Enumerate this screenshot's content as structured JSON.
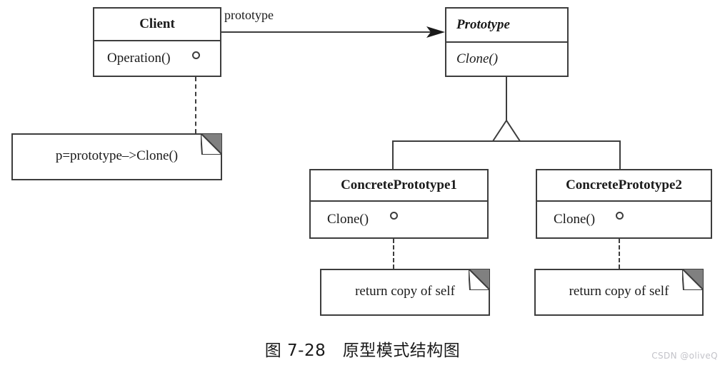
{
  "diagram": {
    "type": "uml-class-diagram",
    "caption": "图 7-28　原型模式结构图",
    "watermark": "CSDN @oliveQ",
    "classes": [
      {
        "id": "client",
        "name": "Client",
        "abstract": false,
        "members": "Operation()"
      },
      {
        "id": "prototype",
        "name": "Prototype",
        "abstract": true,
        "members": "Clone()"
      },
      {
        "id": "concrete1",
        "name": "ConcretePrototype1",
        "abstract": false,
        "members": "Clone()"
      },
      {
        "id": "concrete2",
        "name": "ConcretePrototype2",
        "abstract": false,
        "members": "Clone()"
      }
    ],
    "notes": [
      {
        "id": "note-client",
        "text": "p=prototype–>Clone()"
      },
      {
        "id": "note-concrete1",
        "text": "return copy of self"
      },
      {
        "id": "note-concrete2",
        "text": "return copy of self"
      }
    ],
    "edges": [
      {
        "id": "client-prototype",
        "from": "client",
        "to": "prototype",
        "label": "prototype",
        "kind": "association-directed"
      },
      {
        "id": "concrete1-prototype",
        "from": "concrete1",
        "to": "prototype",
        "label": "",
        "kind": "generalization"
      },
      {
        "id": "concrete2-prototype",
        "from": "concrete2",
        "to": "prototype",
        "label": "",
        "kind": "generalization"
      }
    ],
    "colors": {
      "stroke": "#3d3d3d",
      "fill": "#ffffff",
      "note_fold": "#808080",
      "watermark": "#c3c3c9"
    }
  }
}
